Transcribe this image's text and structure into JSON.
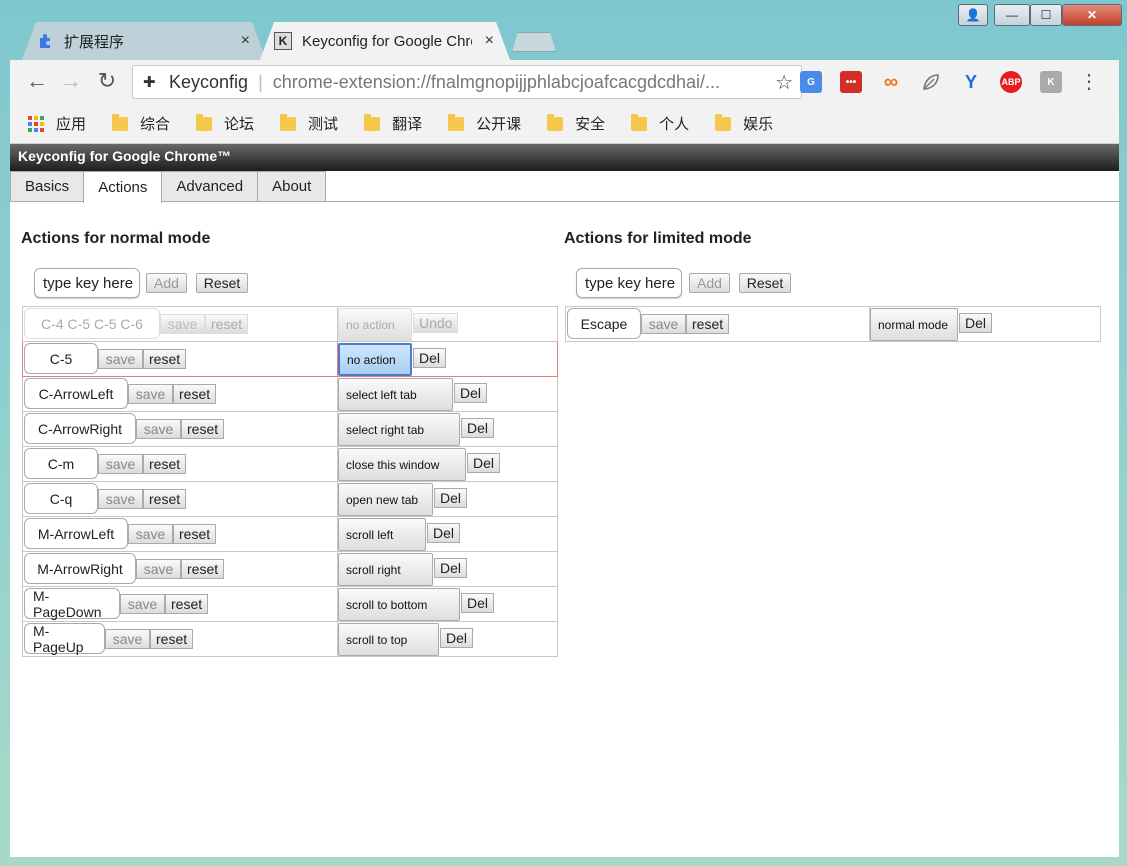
{
  "window": {
    "controls": {
      "user": "👤",
      "minimize": "—",
      "maximize": "☐",
      "close": "✕"
    }
  },
  "tabs": [
    {
      "title": "扩展程序",
      "close": "×"
    },
    {
      "title": "Keyconfig for Google Chrome",
      "close": "×"
    }
  ],
  "toolbar": {
    "back": "←",
    "forward": "→",
    "reload": "↻",
    "site_name": "Keyconfig",
    "url": "chrome-extension://fnalmgnopijjphlabcjoafcacgdcdhai/...",
    "star": "☆",
    "extensions": [
      {
        "name": "translate-icon",
        "color": "#4a8bea",
        "label": "G"
      },
      {
        "name": "lastpass-icon",
        "color": "#d32d27",
        "label": "•••"
      },
      {
        "name": "infinity-icon",
        "color": "#f0731f",
        "label": "∞"
      },
      {
        "name": "leaf-icon",
        "color": "#ffffff",
        "label": ""
      },
      {
        "name": "vimium-icon",
        "color": "#1a6ed8",
        "label": "Y"
      },
      {
        "name": "adblock-icon",
        "color": "#e51c23",
        "label": "ABP"
      },
      {
        "name": "keyconfig-icon",
        "color": "#aaaaaa",
        "label": "K"
      }
    ],
    "menu": "⋮"
  },
  "bookmarks": [
    {
      "label": "应用",
      "type": "apps"
    },
    {
      "label": "综合",
      "type": "folder"
    },
    {
      "label": "论坛",
      "type": "folder"
    },
    {
      "label": "测试",
      "type": "folder"
    },
    {
      "label": "翻译",
      "type": "folder"
    },
    {
      "label": "公开课",
      "type": "folder"
    },
    {
      "label": "安全",
      "type": "folder"
    },
    {
      "label": "个人",
      "type": "folder"
    },
    {
      "label": "娱乐",
      "type": "folder"
    }
  ],
  "page": {
    "app_title": "Keyconfig for Google Chrome™",
    "tabs": [
      "Basics",
      "Actions",
      "Advanced",
      "About"
    ],
    "normal": {
      "title": "Actions for normal mode",
      "placeholder": "type key here",
      "add": "Add",
      "reset": "Reset",
      "pending": {
        "key": "C-4 C-5 C-5 C-6",
        "save": "save",
        "reset": "reset",
        "action": "no action",
        "undo": "Undo"
      },
      "rows": [
        {
          "key": "C-5",
          "save": "save",
          "reset": "reset",
          "action": "no action",
          "del": "Del"
        },
        {
          "key": "C-ArrowLeft",
          "save": "save",
          "reset": "reset",
          "action": "select left tab",
          "del": "Del"
        },
        {
          "key": "C-ArrowRight",
          "save": "save",
          "reset": "reset",
          "action": "select right tab",
          "del": "Del"
        },
        {
          "key": "C-m",
          "save": "save",
          "reset": "reset",
          "action": "close this window",
          "del": "Del"
        },
        {
          "key": "C-q",
          "save": "save",
          "reset": "reset",
          "action": "open new tab",
          "del": "Del"
        },
        {
          "key": "M-ArrowLeft",
          "save": "save",
          "reset": "reset",
          "action": "scroll left",
          "del": "Del"
        },
        {
          "key": "M-ArrowRight",
          "save": "save",
          "reset": "reset",
          "action": "scroll right",
          "del": "Del"
        },
        {
          "key": "M-PageDown",
          "save": "save",
          "reset": "reset",
          "action": "scroll to bottom",
          "del": "Del"
        },
        {
          "key": "M-PageUp",
          "save": "save",
          "reset": "reset",
          "action": "scroll to top",
          "del": "Del"
        }
      ]
    },
    "limited": {
      "title": "Actions for limited mode",
      "placeholder": "type key here",
      "add": "Add",
      "reset": "Reset",
      "rows": [
        {
          "key": "Escape",
          "save": "save",
          "reset": "reset",
          "action": "normal mode",
          "del": "Del"
        }
      ]
    }
  }
}
